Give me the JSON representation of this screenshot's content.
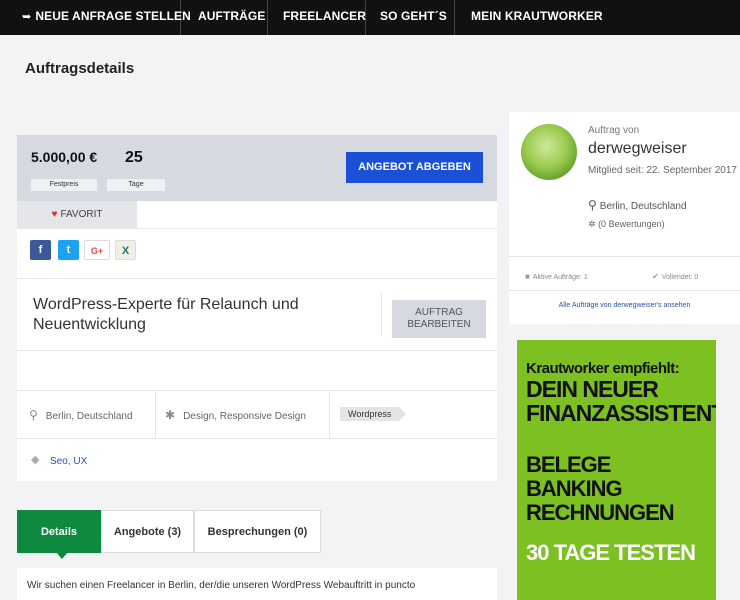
{
  "nav": {
    "items": [
      {
        "label": "NEUE ANFRAGE STELLEN",
        "icon": "arrow-right-icon"
      },
      {
        "label": "AUFTRÄGE"
      },
      {
        "label": "FREELANCER"
      },
      {
        "label": "SO GEHT´S"
      },
      {
        "label": "MEIN KRAUTWORKER"
      }
    ]
  },
  "page": {
    "title": "Auftragsdetails"
  },
  "job": {
    "price": "5.000,00 €",
    "price_label": "Festpreis",
    "days": "25",
    "days_label": "Tage",
    "offer_button": "ANGEBOT ABGEBEN",
    "favorite": "FAVORIT",
    "share": {
      "facebook": "f",
      "twitter": "t",
      "googleplus": "G+",
      "xing": "X"
    },
    "title": "WordPress-Experte für Relaunch und Neuentwicklung",
    "edit_button_line1": "AUFTRAG",
    "edit_button_line2": "BEARBEITEN",
    "location": "Berlin, Deutschland",
    "category": "Design, Responsive Design",
    "tag": "Wordpress",
    "skills": "Seo, UX"
  },
  "tabs": [
    {
      "label": "Details",
      "active": true
    },
    {
      "label": "Angebote (3)",
      "active": false
    },
    {
      "label": "Besprechungen (0)",
      "active": false
    }
  ],
  "description": "Wir suchen einen Freelancer in Berlin, der/die unseren WordPress Webauftritt in puncto",
  "owner": {
    "by_label": "Auftrag von",
    "name": "derwegweiser",
    "member_since": "Mitglied seit: 22. September 2017",
    "location": "Berlin, Deutschland",
    "rating": "(0 Bewertungen)",
    "active_jobs": "Aktive Aufträge: 1",
    "completed": "Vollendet: 0",
    "all_jobs_link": "Alle Aufträge von derwegweiser's ansehen"
  },
  "ad": {
    "line1": "Krautworker empfiehlt:",
    "line2": "DEIN NEUER",
    "line3": "FINANZASSISTENT",
    "line4": "BELEGE",
    "line5": "BANKING",
    "line6": "RECHNUNGEN",
    "cta": "30 TAGE TESTEN"
  },
  "colors": {
    "nav_bg": "#111111",
    "primary_button": "#1a4fd6",
    "active_tab": "#0d8a3f",
    "ad_bg": "#7dc022",
    "heart": "#d8333c"
  }
}
